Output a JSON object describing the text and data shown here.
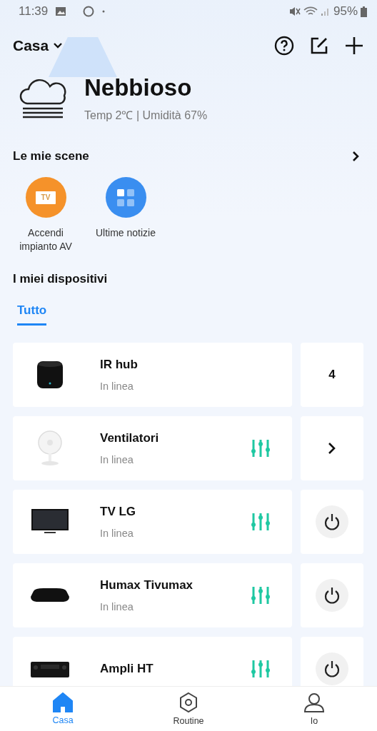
{
  "status_bar": {
    "time": "11:39",
    "battery": "95%"
  },
  "header": {
    "home": "Casa"
  },
  "weather": {
    "condition": "Nebbioso",
    "details": "Temp 2℃ | Umidità 67%"
  },
  "scenes": {
    "title": "Le mie scene",
    "items": [
      {
        "kind": "tv",
        "label": "Accendi impianto AV",
        "icon_text": "TV",
        "color": "#f5922a"
      },
      {
        "kind": "grid",
        "label": "Ultime notizie",
        "color": "#3a8ef0"
      }
    ]
  },
  "devices": {
    "title": "I miei dispositivi",
    "tabs": [
      {
        "label": "Tutto",
        "selected": true
      }
    ],
    "items": [
      {
        "kind": "hub",
        "name": "IR hub",
        "status": "In linea",
        "controls": false,
        "action": {
          "kind": "count",
          "text": "4"
        }
      },
      {
        "kind": "fan",
        "name": "Ventilatori",
        "status": "In linea",
        "controls": true,
        "action": {
          "kind": "chevron"
        }
      },
      {
        "kind": "tv",
        "name": "TV LG",
        "status": "In linea",
        "controls": true,
        "action": {
          "kind": "power"
        }
      },
      {
        "kind": "box",
        "name": "Humax Tivumax",
        "status": "In linea",
        "controls": true,
        "action": {
          "kind": "power"
        }
      },
      {
        "kind": "amp",
        "name": "Ampli HT",
        "controls": true,
        "action": {
          "kind": "power"
        }
      }
    ]
  },
  "bottom_nav": [
    {
      "kind": "home",
      "label": "Casa",
      "selected": true
    },
    {
      "kind": "routine",
      "label": "Routine",
      "selected": false
    },
    {
      "kind": "user",
      "label": "Io",
      "selected": false
    }
  ]
}
